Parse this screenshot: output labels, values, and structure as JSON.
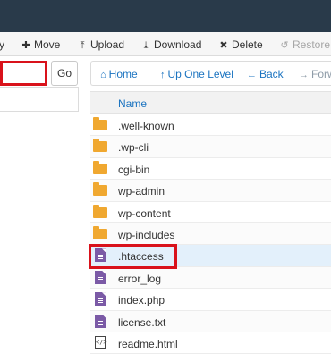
{
  "toolbar": {
    "partial_label": "y",
    "move": "Move",
    "upload": "Upload",
    "download": "Download",
    "delete": "Delete",
    "restore": "Restore"
  },
  "path_bar": {
    "path_value": "",
    "go_label": "Go"
  },
  "nav": {
    "home": "Home",
    "up_one_level": "Up One Level",
    "back": "Back",
    "forward": "Forw"
  },
  "list": {
    "column_name": "Name",
    "items": [
      {
        "name": ".well-known",
        "type": "folder"
      },
      {
        "name": ".wp-cli",
        "type": "folder"
      },
      {
        "name": "cgi-bin",
        "type": "folder"
      },
      {
        "name": "wp-admin",
        "type": "folder"
      },
      {
        "name": "wp-content",
        "type": "folder"
      },
      {
        "name": "wp-includes",
        "type": "folder"
      },
      {
        "name": ".htaccess",
        "type": "file"
      },
      {
        "name": "error_log",
        "type": "file"
      },
      {
        "name": "index.php",
        "type": "file"
      },
      {
        "name": "license.txt",
        "type": "file"
      },
      {
        "name": "readme.html",
        "type": "html"
      }
    ]
  },
  "colors": {
    "accent": "#1a73c0",
    "highlight": "#d9121b",
    "topbar": "#293a4a",
    "folder": "#f0a830",
    "file": "#7b5aa6"
  }
}
